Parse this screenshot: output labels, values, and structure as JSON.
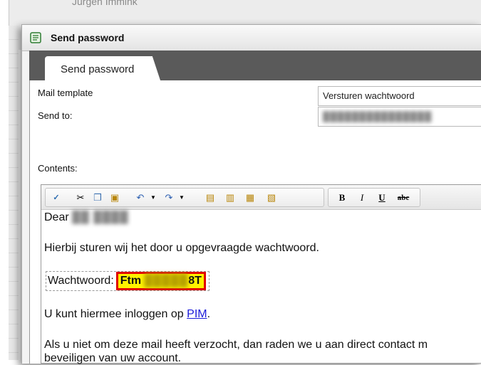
{
  "background_window": {
    "title": "Jurgen Immink"
  },
  "dialog": {
    "title": "Send password",
    "icon": "document-icon",
    "tab_label": "Send password",
    "mail_template_label": "Mail template",
    "mail_template_value": "Versturen wachtwoord",
    "send_to_label": "Send to:",
    "send_to_value": "███████████████",
    "contents_label": "Contents:"
  },
  "toolbar": {
    "spellcheck": "spellcheck-icon",
    "cut": "cut-icon",
    "copy": "copy-icon",
    "paste": "paste-icon",
    "undo": "undo-icon",
    "redo": "redo-icon",
    "paste_text": "paste-text-icon",
    "paste_word": "paste-word-icon",
    "paste_special": "paste-special-icon",
    "paste_formatted": "paste-formatted-icon",
    "bold_label": "B",
    "italic_label": "I",
    "underline_label": "U",
    "strike_label": "abc"
  },
  "email": {
    "greeting": "Dear",
    "greeting_name": "██ ████",
    "line1": "Hierbij sturen wij het door u opgevraagde wachtwoord.",
    "password_label": "Wachtwoord:",
    "password_prefix": "Ftm",
    "password_masked": "█████",
    "password_suffix": "8T",
    "login_text": "U kunt hiermee inloggen op",
    "login_link": "PIM",
    "login_end": ".",
    "line3a": "Als u niet om deze mail heeft verzocht, dan raden we u aan direct contact m",
    "line3b": "beveiligen van uw account."
  },
  "colors": {
    "highlight": "#fff200",
    "highlight_border": "#e00000",
    "link": "#1a1ad9",
    "tabstrip": "#5a5a5a"
  }
}
